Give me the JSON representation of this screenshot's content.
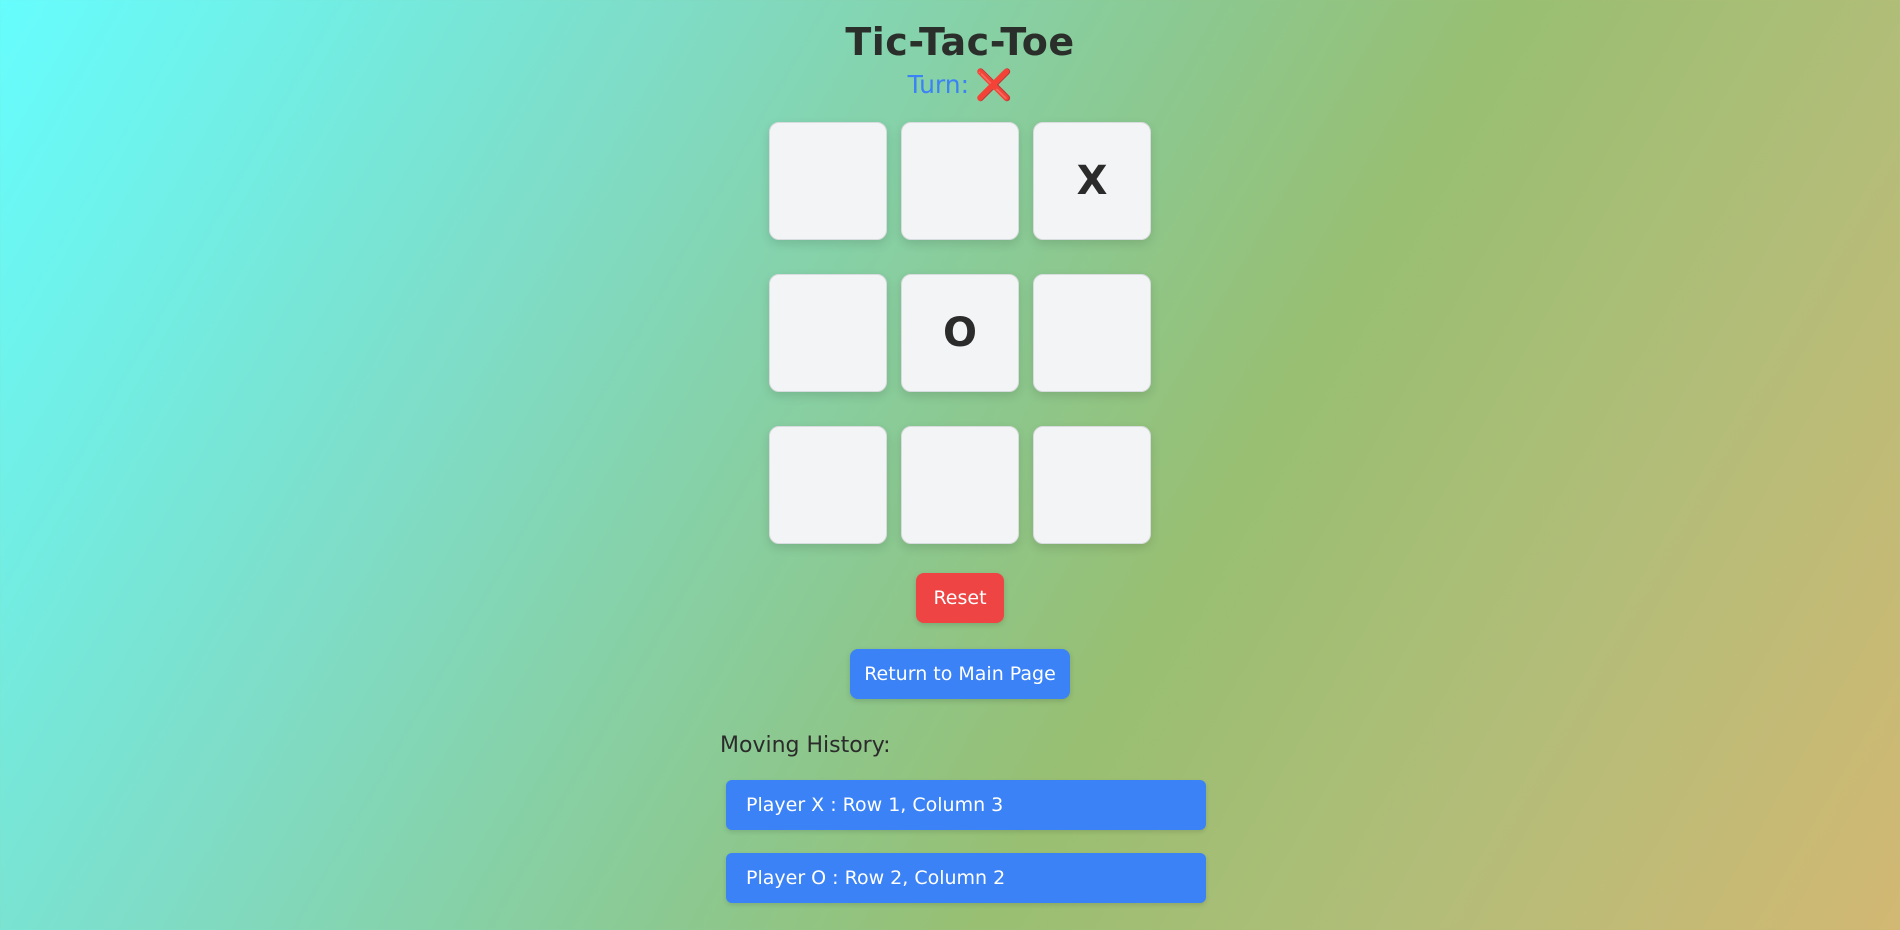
{
  "header": {
    "title": "Tic-Tac-Toe",
    "turn_label": "Turn:",
    "turn_mark": "❌"
  },
  "board": {
    "cells": [
      {
        "row": 1,
        "column": 1,
        "value": ""
      },
      {
        "row": 1,
        "column": 2,
        "value": ""
      },
      {
        "row": 1,
        "column": 3,
        "value": "X"
      },
      {
        "row": 2,
        "column": 1,
        "value": ""
      },
      {
        "row": 2,
        "column": 2,
        "value": "O"
      },
      {
        "row": 2,
        "column": 3,
        "value": ""
      },
      {
        "row": 3,
        "column": 1,
        "value": ""
      },
      {
        "row": 3,
        "column": 2,
        "value": ""
      },
      {
        "row": 3,
        "column": 3,
        "value": ""
      }
    ]
  },
  "controls": {
    "reset_label": "Reset",
    "main_page_label": "Return to Main Page"
  },
  "history": {
    "heading": "Moving History:",
    "moves": [
      "Player X : Row 1, Column 3",
      "Player O : Row 2, Column 2"
    ]
  },
  "colors": {
    "reset": "#ef4444",
    "primary": "#3b82f6",
    "turn_text": "#3b82f6",
    "turn_mark": "#e8334f"
  }
}
